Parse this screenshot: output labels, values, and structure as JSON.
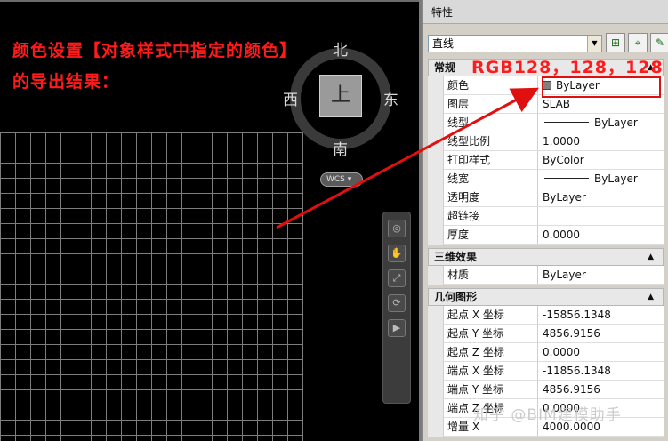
{
  "caption": {
    "line1": "颜色设置【对象样式中指定的颜色】",
    "line2": "的导出结果："
  },
  "viewcube": {
    "top_face": "上",
    "north": "北",
    "south": "南",
    "east": "东",
    "west": "西",
    "ucs_label": "WCS"
  },
  "panel": {
    "title": "特性",
    "object_type": "直线",
    "sections": [
      {
        "header": "常规",
        "rows": [
          {
            "name": "颜色",
            "value": "ByLayer",
            "kind": "color"
          },
          {
            "name": "图层",
            "value": "SLAB"
          },
          {
            "name": "线型",
            "value": "ByLayer",
            "kind": "line"
          },
          {
            "name": "线型比例",
            "value": "1.0000"
          },
          {
            "name": "打印样式",
            "value": "ByColor"
          },
          {
            "name": "线宽",
            "value": "ByLayer",
            "kind": "line"
          },
          {
            "name": "透明度",
            "value": "ByLayer"
          },
          {
            "name": "超链接",
            "value": ""
          },
          {
            "name": "厚度",
            "value": "0.0000"
          }
        ]
      },
      {
        "header": "三维效果",
        "rows": [
          {
            "name": "材质",
            "value": "ByLayer"
          }
        ]
      },
      {
        "header": "几何图形",
        "rows": [
          {
            "name": "起点 X 坐标",
            "value": "-15856.1348"
          },
          {
            "name": "起点 Y 坐标",
            "value": "4856.9156"
          },
          {
            "name": "起点 Z 坐标",
            "value": "0.0000"
          },
          {
            "name": "端点 X 坐标",
            "value": "-11856.1348"
          },
          {
            "name": "端点 Y 坐标",
            "value": "4856.9156"
          },
          {
            "name": "端点 Z 坐标",
            "value": "0.0000"
          },
          {
            "name": "增量 X",
            "value": "4000.0000"
          }
        ]
      }
    ]
  },
  "annotation": {
    "rgb_text": "RGB128，128，128",
    "color": "#ff1b1b"
  },
  "watermark": "知乎 @BIM建模助手"
}
